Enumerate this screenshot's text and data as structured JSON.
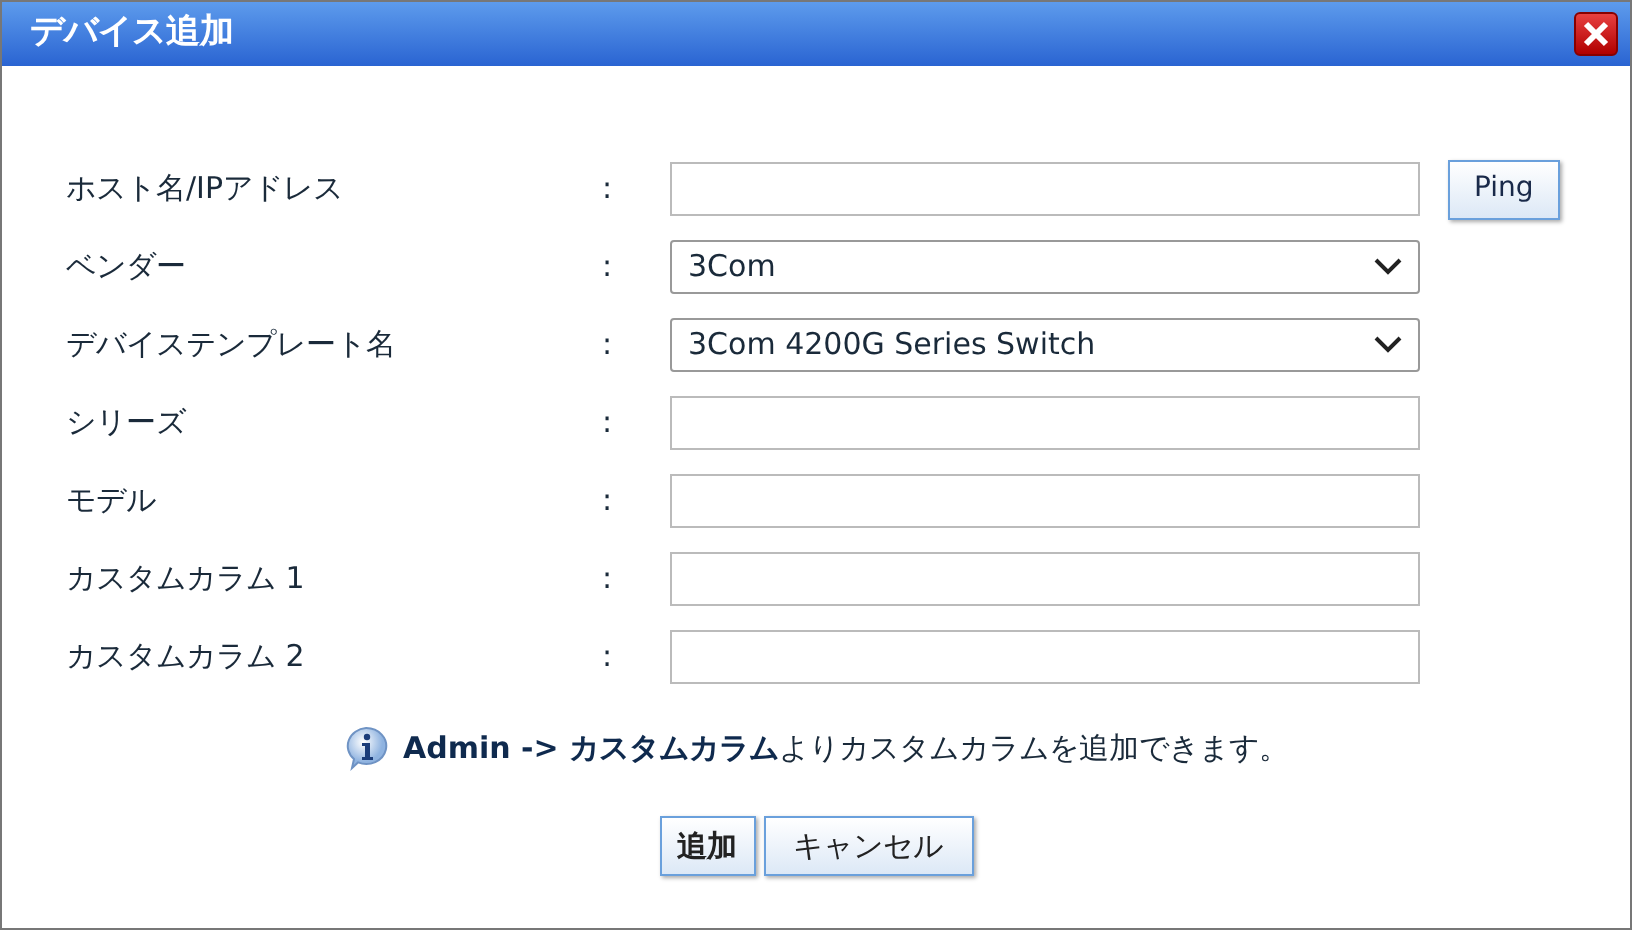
{
  "window": {
    "title": "デバイス追加"
  },
  "fields": [
    {
      "label": "ホスト名/IPアドレス",
      "separator": ":",
      "kind": "text",
      "button": "Ping"
    },
    {
      "label": "ベンダー",
      "separator": ":",
      "kind": "select",
      "value": "3Com"
    },
    {
      "label": "デバイステンプレート名",
      "separator": ":",
      "kind": "select",
      "value": "3Com 4200G Series Switch"
    },
    {
      "label": "シリーズ",
      "separator": ":",
      "kind": "text"
    },
    {
      "label": "モデル",
      "separator": ":",
      "kind": "text"
    },
    {
      "label": "カスタムカラム 1",
      "separator": ":",
      "kind": "text"
    },
    {
      "label": "カスタムカラム 2",
      "separator": ":",
      "kind": "text"
    }
  ],
  "note": "**Admin -> カスタムカラム**よりカスタムカラムを追加できます。",
  "buttons": [
    {
      "label": "追加",
      "kind": "primary"
    },
    {
      "label": "キャンセル",
      "kind": "secondary"
    }
  ]
}
